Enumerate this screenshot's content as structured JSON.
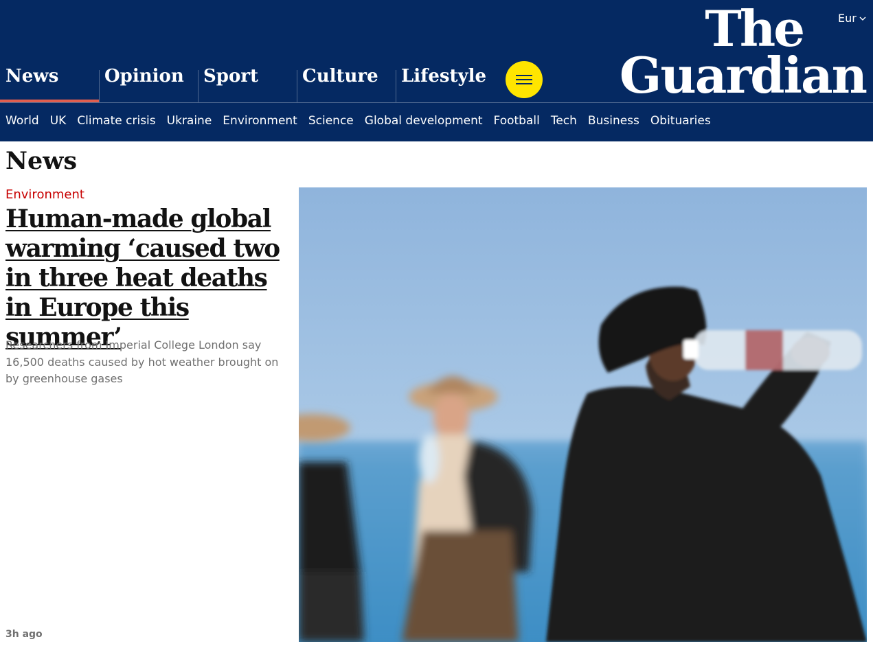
{
  "header": {
    "edition_label": "Eur",
    "logo_line1": "The",
    "logo_line2": "Guardian",
    "pillars": [
      {
        "label": "News",
        "active": true
      },
      {
        "label": "Opinion",
        "active": false
      },
      {
        "label": "Sport",
        "active": false
      },
      {
        "label": "Culture",
        "active": false
      },
      {
        "label": "Lifestyle",
        "active": false
      }
    ],
    "menu_icon": "hamburger-icon",
    "subnav": [
      "World",
      "UK",
      "Climate crisis",
      "Ukraine",
      "Environment",
      "Science",
      "Global development",
      "Football",
      "Tech",
      "Business",
      "Obituaries"
    ]
  },
  "main": {
    "section_title": "News",
    "article": {
      "kicker": "Environment",
      "headline": "Human-made global warming ‘caused two in three heat deaths in Europe this summer’",
      "standfirst": "Researchers from Imperial College London say 16,500 deaths caused by hot weather brought on by greenhouse gases",
      "age": "3h ago"
    }
  },
  "colors": {
    "masthead": "#052962",
    "menu_button": "#ffe500",
    "kicker": "#c70000",
    "active_pillar_underline": "#e05e4f"
  }
}
